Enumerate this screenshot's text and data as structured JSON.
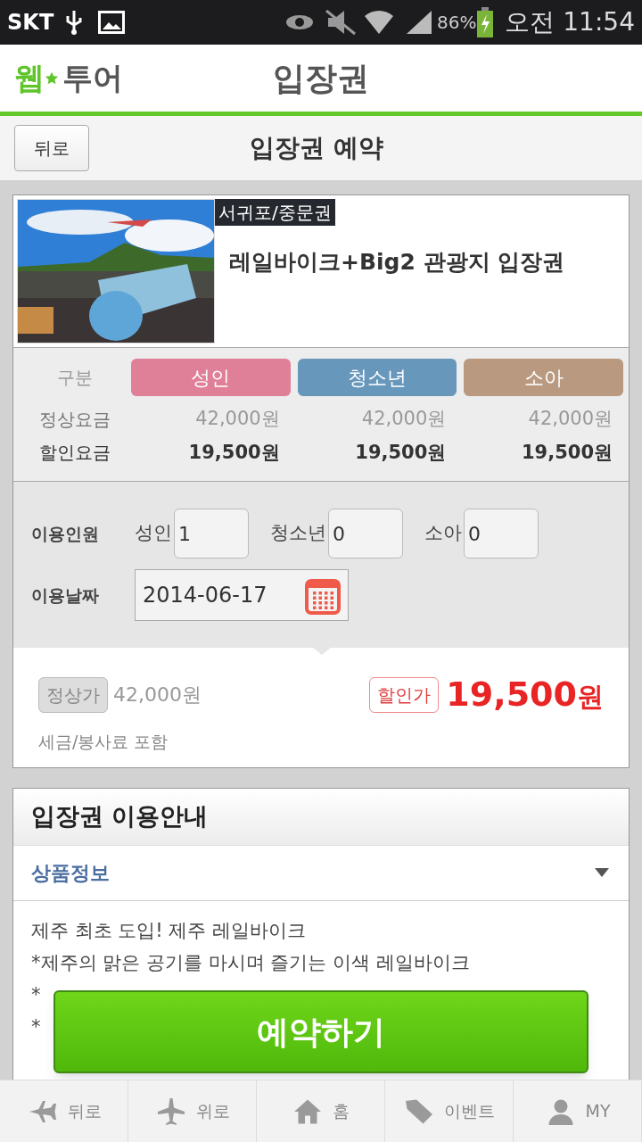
{
  "status_bar": {
    "carrier": "SKT",
    "battery": "86%",
    "time": "오전 11:54"
  },
  "header": {
    "logo_accent": "웹",
    "logo_rest": "투어",
    "title": "입장권"
  },
  "subheader": {
    "back_button": "뒤로",
    "title": "입장권 예약"
  },
  "product": {
    "region": "서귀포/중문권",
    "name": "레일바이크+Big2 관광지 입장권"
  },
  "fare_table": {
    "header_label": "구분",
    "row_labels": [
      "정상요금",
      "할인요금"
    ],
    "columns": [
      {
        "label": "성인",
        "color": "#e07f98",
        "regular": "42,000원",
        "discount": "19,500원"
      },
      {
        "label": "청소년",
        "color": "#6797bb",
        "regular": "42,000원",
        "discount": "19,500원"
      },
      {
        "label": "소아",
        "color": "#b99a80",
        "regular": "42,000원",
        "discount": "19,500원"
      }
    ]
  },
  "booking": {
    "people_label": "이용인원",
    "people": [
      {
        "label": "성인",
        "value": "1"
      },
      {
        "label": "청소년",
        "value": "0"
      },
      {
        "label": "소아",
        "value": "0"
      }
    ],
    "date_label": "이용날짜",
    "date": "2014-06-17"
  },
  "price": {
    "regular_tag": "정상가",
    "regular": "42,000원",
    "discount_tag": "할인가",
    "discount_amount": "19,500",
    "discount_unit": "원",
    "note": "세금/봉사료 포함"
  },
  "guide": {
    "title": "입장권 이용안내",
    "section": {
      "label": "상품정보",
      "expanded": true
    },
    "lines": [
      "제주 최초 도입! 제주 레일바이크",
      "*제주의 맑은 공기를 마시며 즐기는 이색 레일바이크",
      "*",
      "*"
    ]
  },
  "reserve_button": "예약하기",
  "bottom_nav": [
    {
      "kind": "plane-left",
      "label": "뒤로"
    },
    {
      "kind": "plane-up",
      "label": "위로"
    },
    {
      "kind": "home",
      "label": "홈"
    },
    {
      "kind": "tag",
      "label": "이벤트"
    },
    {
      "kind": "user",
      "label": "MY"
    }
  ]
}
